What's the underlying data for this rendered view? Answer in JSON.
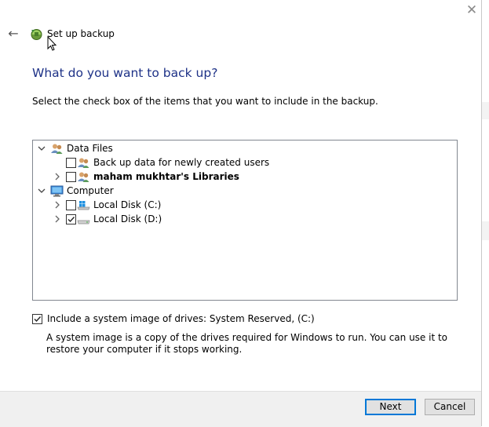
{
  "window": {
    "title": "Set up backup",
    "close_glyph": "✕",
    "back_glyph": "←",
    "app_icon": "backup-icon"
  },
  "main": {
    "heading": "What do you want to back up?",
    "instruction": "Select the check box of the items that you want to include in the backup."
  },
  "tree": {
    "data_files": {
      "label": "Data Files",
      "expanded": true,
      "icon": "users-icon"
    },
    "new_users": {
      "label": "Back up data for newly created users",
      "checked": false,
      "icon": "users-icon"
    },
    "libraries": {
      "label": "maham mukhtar's Libraries",
      "checked": false,
      "expanded": false,
      "icon": "user-icon"
    },
    "computer": {
      "label": "Computer",
      "expanded": true,
      "icon": "computer-icon"
    },
    "disk_c": {
      "label": "Local Disk (C:)",
      "checked": false,
      "expanded": false,
      "icon": "windows-drive-icon"
    },
    "disk_d": {
      "label": "Local Disk (D:)",
      "checked": true,
      "expanded": false,
      "icon": "drive-icon"
    }
  },
  "system_image": {
    "label": "Include a system image of drives: System Reserved, (C:)",
    "checked": true,
    "description": "A system image is a copy of the drives required for Windows to run. You can use it to restore your computer if it stops working."
  },
  "footer": {
    "next_label": "Next",
    "cancel_label": "Cancel"
  },
  "colors": {
    "heading": "#1e3287",
    "accent": "#0078d7",
    "footer_bg": "#f0f0f0"
  }
}
